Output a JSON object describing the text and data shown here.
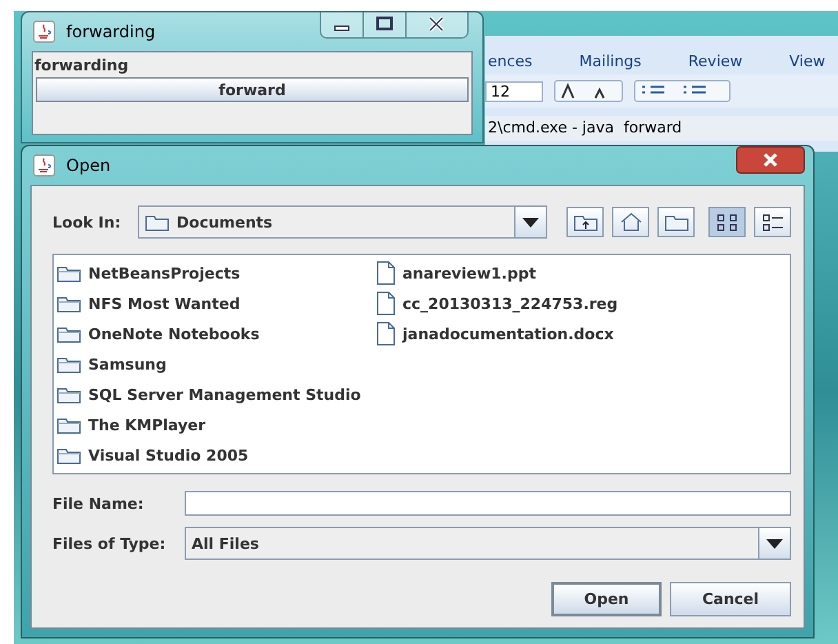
{
  "background_window": {
    "tabs": [
      "ences",
      "Mailings",
      "Review",
      "View"
    ],
    "font_size": "12",
    "console_title": "2\\cmd.exe - java  forward"
  },
  "forwarding_window": {
    "title": "forwarding",
    "label": "forwarding",
    "button": "forward"
  },
  "open_dialog": {
    "title": "Open",
    "look_in_label": "Look In:",
    "look_in_value": "Documents",
    "toolbar": [
      {
        "kind": "up",
        "selected": false
      },
      {
        "kind": "home",
        "selected": false
      },
      {
        "kind": "new-folder",
        "selected": false
      },
      {
        "kind": "list",
        "selected": true
      },
      {
        "kind": "details",
        "selected": false
      }
    ],
    "items": [
      {
        "name": "NetBeansProjects",
        "kind": "folder"
      },
      {
        "name": "NFS Most Wanted",
        "kind": "folder"
      },
      {
        "name": "OneNote Notebooks",
        "kind": "folder"
      },
      {
        "name": "Samsung",
        "kind": "folder"
      },
      {
        "name": "SQL Server Management Studio",
        "kind": "folder"
      },
      {
        "name": "The KMPlayer",
        "kind": "folder"
      },
      {
        "name": "Visual Studio 2005",
        "kind": "folder"
      },
      {
        "name": "anareview1.ppt",
        "kind": "file"
      },
      {
        "name": "cc_20130313_224753.reg",
        "kind": "file"
      },
      {
        "name": "janadocumentation.docx",
        "kind": "file"
      }
    ],
    "file_name_label": "File Name:",
    "files_of_type_label": "Files of Type:",
    "files_of_type_value": "All Files",
    "buttons": [
      "Open",
      "Cancel"
    ]
  }
}
